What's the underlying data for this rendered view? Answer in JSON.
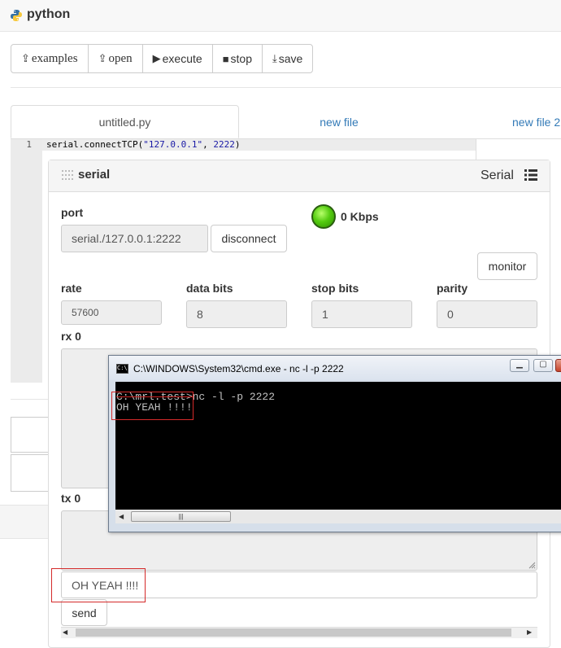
{
  "app": {
    "title": "python",
    "logo_icon": "python-logo-icon"
  },
  "toolbar": {
    "examples_label": "examples",
    "open_label": "open",
    "execute_label": "execute",
    "stop_label": "stop",
    "save_label": "save"
  },
  "tabs": [
    {
      "label": "untitled.py",
      "active": true
    },
    {
      "label": "new file",
      "active": false
    },
    {
      "label": "new file 2",
      "active": false
    }
  ],
  "editor": {
    "line_number": "1",
    "code_prefix": "serial.connectTCP(",
    "code_string": "\"127.0.0.1\"",
    "code_sep": ", ",
    "code_number": "2222",
    "code_suffix": ")"
  },
  "serial_panel": {
    "title": "serial",
    "type_label": "Serial",
    "port_label": "port",
    "port_value": "serial./127.0.0.1:2222",
    "disconnect_label": "disconnect",
    "speed": "0 Kbps",
    "led_color": "#55cc11",
    "monitor_label": "monitor",
    "rate_label": "rate",
    "rate_value": "57600",
    "databits_label": "data bits",
    "databits_value": "8",
    "stopbits_label": "stop bits",
    "stopbits_value": "1",
    "parity_label": "parity",
    "parity_value": "0",
    "rx_label": "rx 0",
    "tx_label": "tx 0",
    "tx_input_value": "OH YEAH !!!!",
    "send_label": "send"
  },
  "cmd_window": {
    "title": "C:\\WINDOWS\\System32\\cmd.exe - nc  -l -p 2222",
    "console_line1": "C:\\mrl.test>nc -l -p 2222",
    "console_line2": "OH YEAH !!!!"
  },
  "colors": {
    "link": "#337ab7",
    "highlight": "#d42a2a",
    "console_bg": "#000000"
  }
}
